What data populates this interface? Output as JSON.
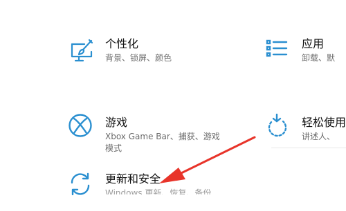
{
  "colors": {
    "accent": "#2a8fd0",
    "arrow": "#e8342a",
    "title_text": "#111111",
    "desc_text": "#6b6b6b"
  },
  "tiles": {
    "personalization": {
      "title": "个性化",
      "desc": "背景、锁屏、颜色",
      "icon": "personalization-icon"
    },
    "apps": {
      "title": "应用",
      "desc": "卸载、默",
      "icon": "apps-list-icon"
    },
    "gaming": {
      "title": "游戏",
      "desc_line1": "Xbox Game Bar、捕获、游戏",
      "desc_line2": "模式",
      "icon": "xbox-icon"
    },
    "ease_of_access": {
      "title": "轻松使用",
      "desc": "讲述人、",
      "icon": "ease-of-access-icon"
    },
    "update_security": {
      "title": "更新和安全",
      "desc_clipped": "Windows 更新、恢复、备份",
      "icon": "refresh-icon"
    }
  },
  "annotation": {
    "icon": "red-arrow-icon",
    "target": "update_security"
  }
}
